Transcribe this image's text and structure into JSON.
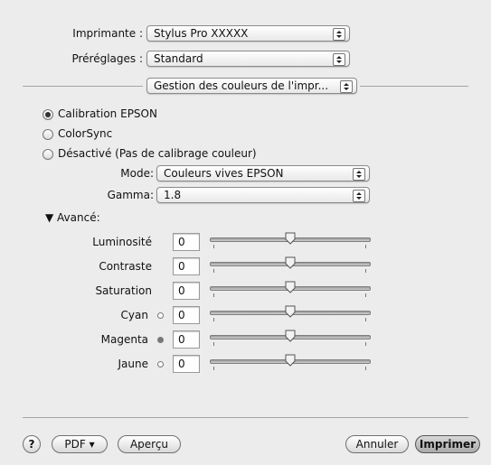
{
  "printer": {
    "label": "Imprimante :",
    "value": "Stylus Pro XXXXX"
  },
  "presets": {
    "label": "Préréglages :",
    "value": "Standard"
  },
  "panel_menu": {
    "value": "Gestion des couleurs de l'impr..."
  },
  "color_options": [
    {
      "label": "Calibration EPSON",
      "selected": true
    },
    {
      "label": "ColorSync",
      "selected": false
    },
    {
      "label": "Désactivé (Pas de calibrage couleur)",
      "selected": false
    }
  ],
  "mode": {
    "label": "Mode:",
    "value": "Couleurs vives EPSON"
  },
  "gamma": {
    "label": "Gamma:",
    "value": "1.8"
  },
  "advanced": {
    "label": "▼ Avancé:"
  },
  "adjustments": [
    {
      "label": "Luminosité",
      "value": "0",
      "color_dot": "none"
    },
    {
      "label": "Contraste",
      "value": "0",
      "color_dot": "none"
    },
    {
      "label": "Saturation",
      "value": "0",
      "color_dot": "none"
    },
    {
      "label": "Cyan",
      "value": "0",
      "color_dot": "outline"
    },
    {
      "label": "Magenta",
      "value": "0",
      "color_dot": "filled"
    },
    {
      "label": "Jaune",
      "value": "0",
      "color_dot": "outline"
    }
  ],
  "footer": {
    "help": "?",
    "pdf": "PDF ▾",
    "preview": "Aperçu",
    "cancel": "Annuler",
    "print": "Imprimer"
  }
}
